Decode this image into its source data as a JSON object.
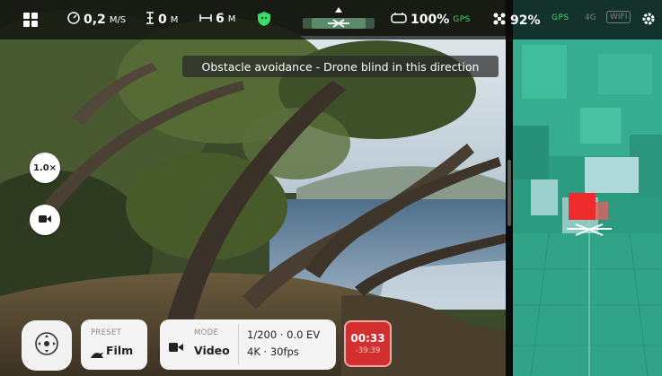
{
  "topbar": {
    "speed_value": "0,2",
    "speed_unit": "M/S",
    "altitude_value": "0",
    "altitude_unit": "M",
    "distance_value": "6",
    "distance_unit": "M",
    "controller_battery": "100%",
    "controller_gps": "GPS",
    "drone_battery": "92%",
    "drone_gps": "GPS",
    "network_4g": "4G",
    "network_wifi": "WIFI"
  },
  "banner": {
    "text": "Obstacle avoidance - Drone blind in this direction"
  },
  "left_controls": {
    "zoom_label": "1.0×"
  },
  "bottom": {
    "preset_label": "PRESET",
    "preset_value": "Film",
    "mode_label": "MODE",
    "mode_value": "Video",
    "exposure": "1/200 · 0.0 EV",
    "format": "4K · 30fps",
    "record_time": "00:33",
    "remaining_time": "-39:39"
  },
  "colors": {
    "accent_green": "#3ddc6a",
    "record_red": "#d32f2f",
    "map_teal": "#2fa98a"
  },
  "icons": [
    "grid-menu-icon",
    "speedometer-icon",
    "altitude-icon",
    "distance-icon",
    "shield-icon",
    "compass-indicator-icon",
    "controller-icon",
    "drone-icon",
    "settings-icon",
    "video-camera-icon",
    "joystick-icon",
    "drone-profile-icon"
  ]
}
